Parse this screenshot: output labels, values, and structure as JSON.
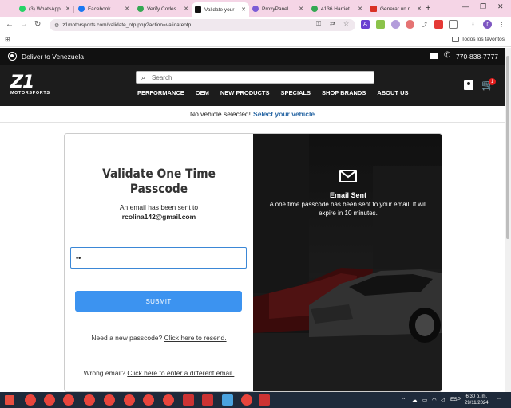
{
  "browser": {
    "tabs": [
      {
        "label": "(3) WhatsApp",
        "color": "#25d366"
      },
      {
        "label": "Facebook",
        "color": "#1877f2"
      },
      {
        "label": "Verify Codes",
        "color": "#34a853"
      },
      {
        "label": "Validate your",
        "color": "#111111"
      },
      {
        "label": "ProxyPanel",
        "color": "#7b5cd6"
      },
      {
        "label": "4136 Harriet",
        "color": "#34a853"
      },
      {
        "label": "Generar un n",
        "color": "#d93025"
      }
    ],
    "url": "z1motorsports.com/validate_otp.php?action=validateotp",
    "all_bookmarks": "Todos los favoritos"
  },
  "site": {
    "deliver_to": "Deliver to Venezuela",
    "phone": "770-838-7777",
    "logo": {
      "text": "Z1",
      "tagline": "MOTORSPORTS"
    },
    "search_placeholder": "Search",
    "nav": [
      "PERFORMANCE",
      "OEM",
      "NEW PRODUCTS",
      "SPECIALS",
      "SHOP BRANDS",
      "ABOUT US"
    ],
    "cart_count": "1",
    "vehicle_status": "No vehicle selected!",
    "vehicle_link": "Select your vehicle"
  },
  "otp_form": {
    "title": "Validate One Time Passcode",
    "sent_line": "An email has been sent to",
    "email": "rcolina142@gmail.com",
    "input_value": "••",
    "submit_label": "SUBMIT",
    "resend_text": "Need a new passcode?",
    "resend_link": "Click here to resend.",
    "wrong_email_text": "Wrong email?",
    "wrong_email_link": "Click here to enter a different email."
  },
  "side_panel": {
    "heading": "Email Sent",
    "description": "A one time passcode has been sent to your email. It will expire in 10 minutes."
  },
  "taskbar": {
    "language": "ESP",
    "time": "6:30 p. m.",
    "date": "29/11/2024"
  }
}
